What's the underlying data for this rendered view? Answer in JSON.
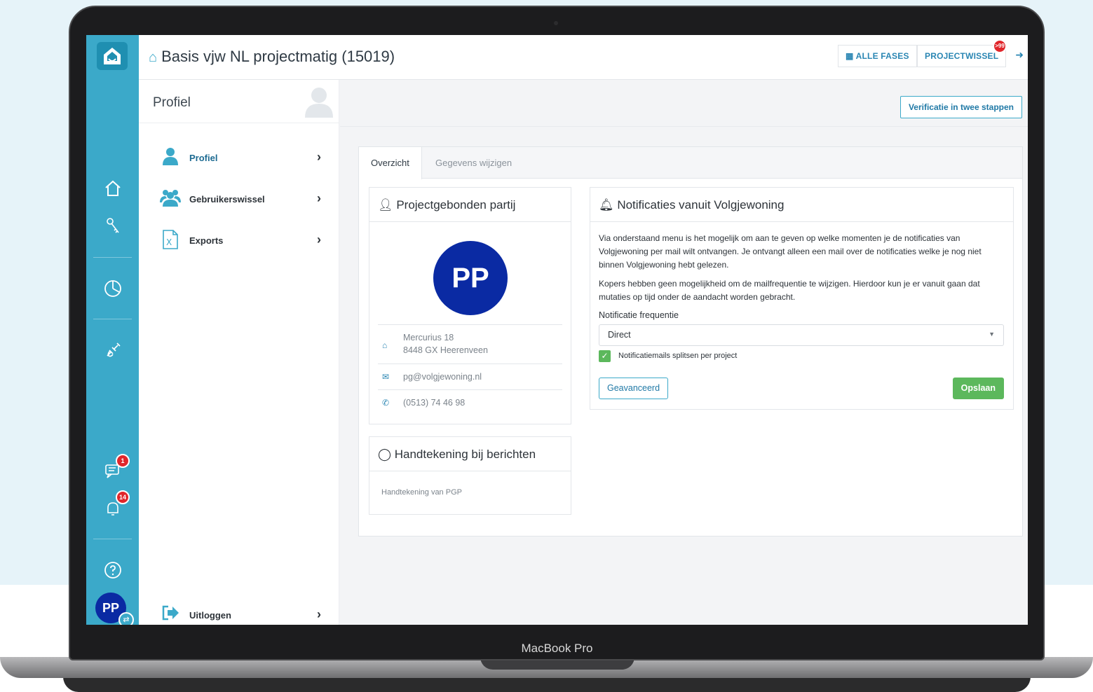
{
  "device": {
    "label": "MacBook Pro"
  },
  "header": {
    "title": "Basis vjw NL projectmatig (15019)",
    "alle_fases": "ALLE FASES",
    "projectwissel": "PROJECTWISSEL",
    "projectwissel_badge": ">99"
  },
  "rail": {
    "messages_badge": "1",
    "notifications_badge": "14",
    "avatar_initials": "PP"
  },
  "sidenav": {
    "title": "Profiel",
    "items": [
      {
        "label": "Profiel",
        "icon": "user-icon",
        "active": true
      },
      {
        "label": "Gebruikerswissel",
        "icon": "users-icon",
        "active": false
      },
      {
        "label": "Exports",
        "icon": "excel-file-icon",
        "active": false
      }
    ],
    "logout": "Uitloggen"
  },
  "main": {
    "verify_button": "Verificatie in twee stappen",
    "tabs": [
      {
        "label": "Overzicht",
        "active": true
      },
      {
        "label": "Gegevens wijzigen",
        "active": false
      }
    ]
  },
  "party_card": {
    "title": "Projectgebonden partij",
    "initials": "PP",
    "address_line1": "Mercurius 18",
    "address_line2": "8448 GX Heerenveen",
    "email": "pg@volgjewoning.nl",
    "phone": "(0513) 74 46 98"
  },
  "signature_card": {
    "title": "Handtekening bij berichten",
    "text": "Handtekening van PGP"
  },
  "notifications_card": {
    "title": "Notificaties vanuit Volgjewoning",
    "paragraph1": "Via onderstaand menu is het mogelijk om aan te geven op welke momenten je de notificaties van Volgjewoning per mail wilt ontvangen. Je ontvangt alleen een mail over de notificaties welke je nog niet binnen Volgjewoning hebt gelezen.",
    "paragraph2": "Kopers hebben geen mogelijkheid om de mailfrequentie te wijzigen. Hierdoor kun je er vanuit gaan dat mutaties op tijd onder de aandacht worden gebracht.",
    "frequency_label": "Notificatie frequentie",
    "frequency_value": "Direct",
    "split_label": "Notificatiemails splitsen per project",
    "split_checked": true,
    "advanced_button": "Geavanceerd",
    "save_button": "Opslaan"
  },
  "colors": {
    "accent": "#3ba9c9",
    "avatar": "#0a2aa3",
    "success": "#5cb85c",
    "badge": "#e0262b"
  }
}
